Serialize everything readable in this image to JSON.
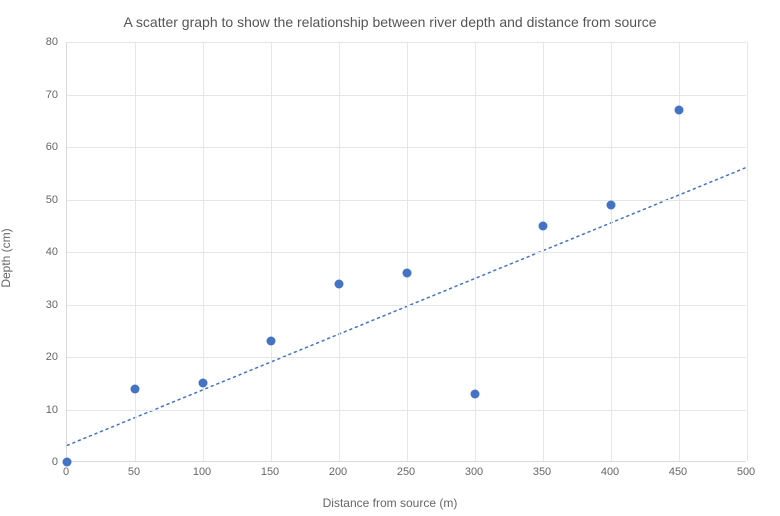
{
  "chart_data": {
    "type": "scatter",
    "title": "A scatter graph to show the relationship between river depth and distance from source",
    "xlabel": "Distance from source (m)",
    "ylabel": "Depth (cm)",
    "xlim": [
      0,
      500
    ],
    "ylim": [
      0,
      80
    ],
    "x_ticks": [
      0,
      50,
      100,
      150,
      200,
      250,
      300,
      350,
      400,
      450,
      500
    ],
    "y_ticks": [
      0,
      10,
      20,
      30,
      40,
      50,
      60,
      70,
      80
    ],
    "points": [
      {
        "x": 0,
        "y": 0
      },
      {
        "x": 50,
        "y": 14
      },
      {
        "x": 100,
        "y": 15
      },
      {
        "x": 150,
        "y": 23
      },
      {
        "x": 200,
        "y": 34
      },
      {
        "x": 250,
        "y": 36
      },
      {
        "x": 300,
        "y": 13
      },
      {
        "x": 350,
        "y": 45
      },
      {
        "x": 400,
        "y": 49
      },
      {
        "x": 450,
        "y": 67
      }
    ],
    "trendline": {
      "x1": 0,
      "y1": 3,
      "x2": 500,
      "y2": 56
    }
  }
}
